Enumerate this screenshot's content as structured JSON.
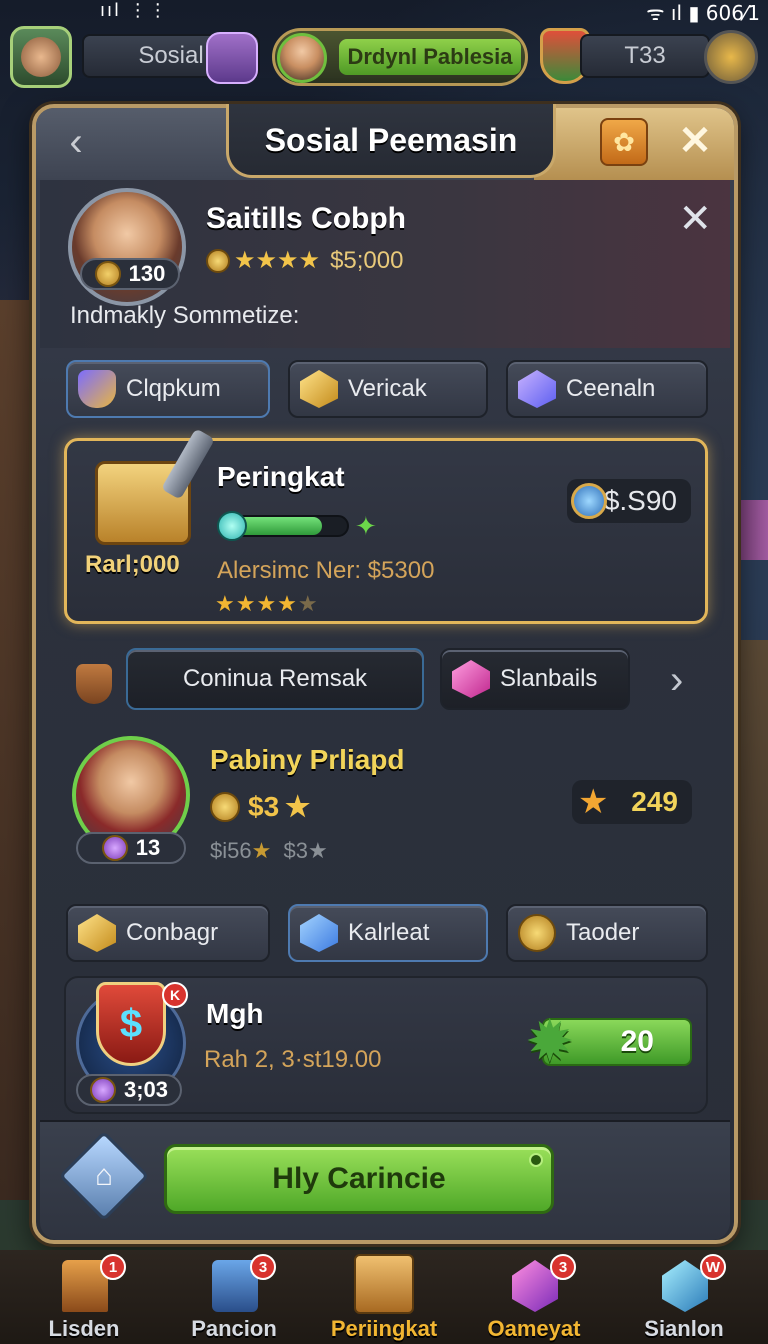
{
  "status": {
    "signal": "ııl ⋮⋮",
    "right": "ᯤ ıl ▮ 606⁄1"
  },
  "hud": {
    "left_label": "Sosial",
    "center_label": "Drdynl Pablesia",
    "right_label": "T33"
  },
  "panel": {
    "title": "Sosial Peemasin",
    "profile": {
      "name": "Saitills Cobph",
      "level": "130",
      "rating_stars": "★★★★",
      "money": "$5;000",
      "subtitle": "Indmakly Sommetize:"
    },
    "tabs_top": [
      "Clqpkum",
      "Vericak",
      "Ceenaln"
    ],
    "featured": {
      "title": "Peringkat",
      "rank_label": "Rarl;000",
      "progress_percent": 80,
      "detail": "Alersimc Ner: $5300",
      "stars": "★★★★",
      "stars_dim": "★",
      "value": "$.S90"
    },
    "mid_buttons": [
      "Coninua Remsak",
      "Slanbails"
    ],
    "player_card": {
      "title": "Pabiny Prliapd",
      "level": "13",
      "coins": "$3",
      "sub": "$i56",
      "sub2": "$3",
      "value": "249"
    },
    "tabs_bottom": [
      "Conbagr",
      "Kalrleat",
      "Taoder"
    ],
    "mgh_card": {
      "title": "Mgh",
      "detail": "Rah 2, 3·st19.00",
      "level": "3;03",
      "value": "20"
    },
    "cta": "Hly Carincie"
  },
  "nav": [
    {
      "label": "Lisden",
      "badge": "1"
    },
    {
      "label": "Pancion",
      "badge": "3"
    },
    {
      "label": "Periingkat",
      "badge": ""
    },
    {
      "label": "Oameyat",
      "badge": "3"
    },
    {
      "label": "Sianlon",
      "badge": "W"
    }
  ],
  "colors": {
    "accent_gold": "#e2b65a",
    "cta_green": "#7cc843",
    "badge_red": "#d8332e"
  }
}
